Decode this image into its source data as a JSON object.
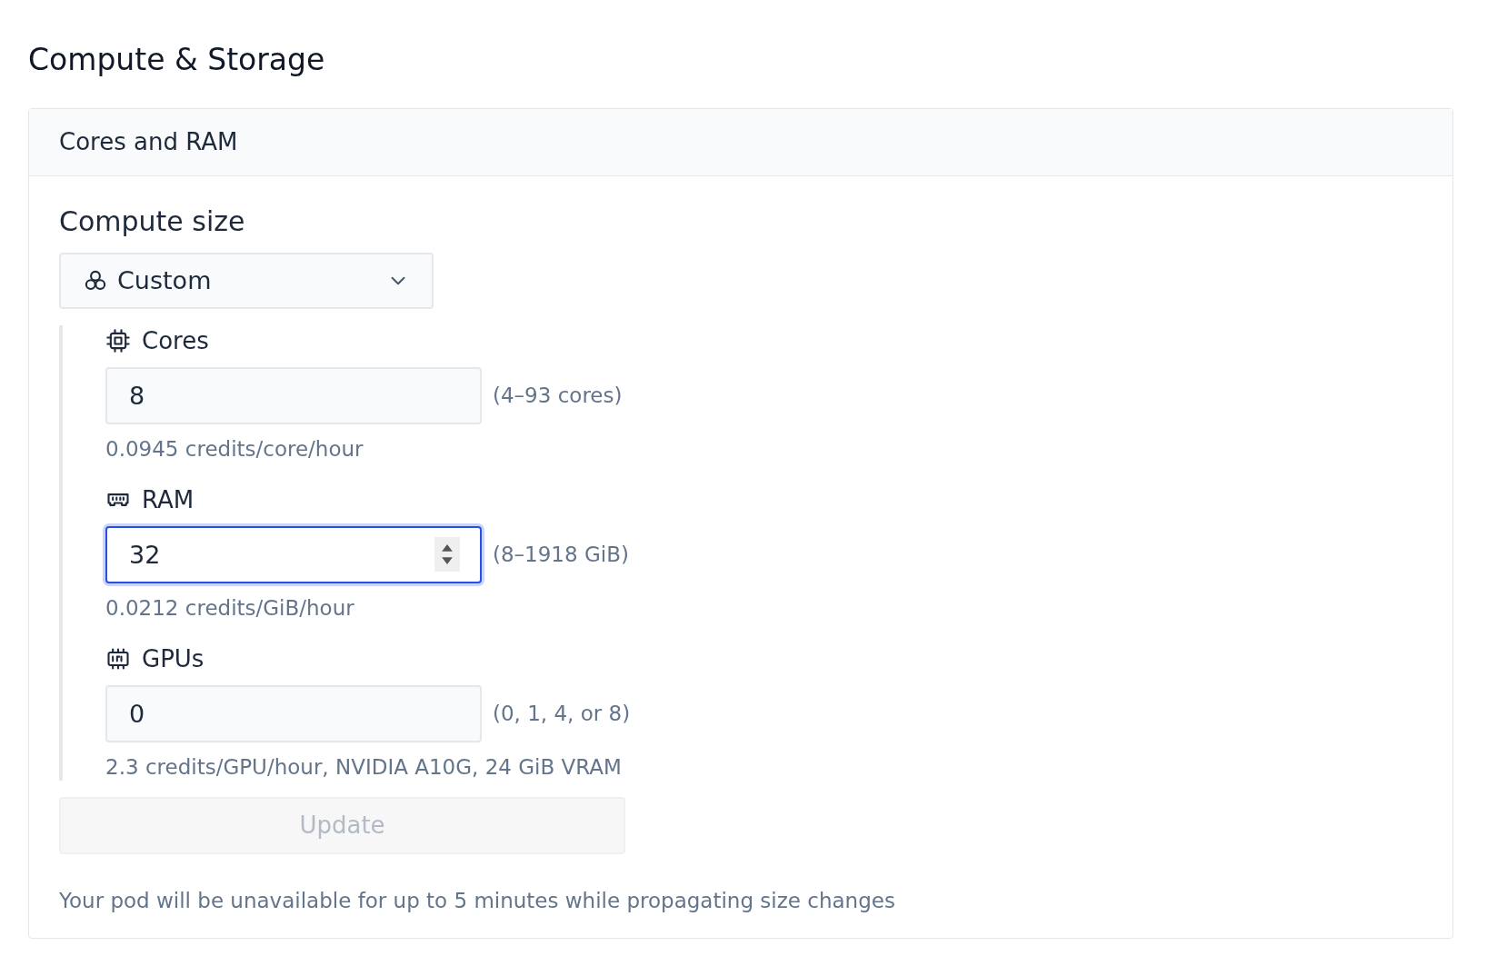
{
  "page_title": "Compute & Storage",
  "card": {
    "header": "Cores and RAM",
    "section_title": "Compute size",
    "size_select": {
      "value": "Custom"
    },
    "fields": [
      {
        "kind": "cores",
        "label": "Cores",
        "value": "8",
        "range": "(4–93 cores)",
        "help": "0.0945 credits/core/hour",
        "focused": false
      },
      {
        "kind": "ram",
        "label": "RAM",
        "value": "32",
        "range": "(8–1918 GiB)",
        "help": "0.0212 credits/GiB/hour",
        "focused": true
      },
      {
        "kind": "gpus",
        "label": "GPUs",
        "value": "0",
        "range": "(0, 1, 4, or 8)",
        "help": "2.3 credits/GPU/hour, NVIDIA A10G, 24 GiB VRAM",
        "focused": false
      }
    ],
    "update_button": {
      "label": "Update",
      "disabled": true
    },
    "note": "Your pod will be unavailable for up to 5 minutes while propagating size changes"
  }
}
